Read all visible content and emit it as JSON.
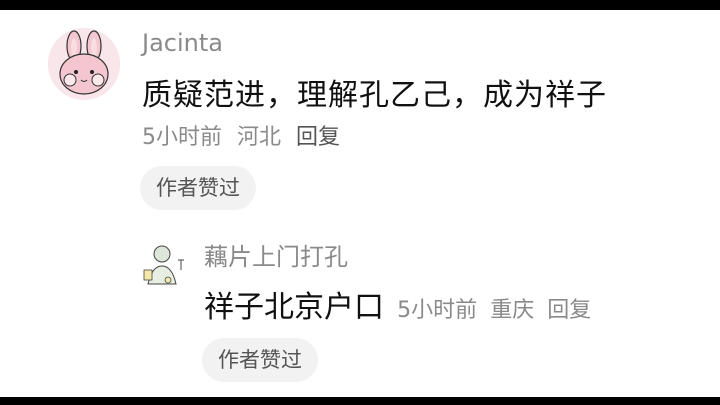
{
  "comment": {
    "username": "Jacinta",
    "text": "质疑范进，理解孔乙己，成为祥子",
    "time": "5小时前",
    "location": "河北",
    "reply_label": "回复",
    "author_liked_label": "作者赞过"
  },
  "reply": {
    "username": "藕片上门打孔",
    "text": "祥子北京户口",
    "time": "5小时前",
    "location": "重庆",
    "reply_label": "回复",
    "author_liked_label": "作者赞过"
  }
}
